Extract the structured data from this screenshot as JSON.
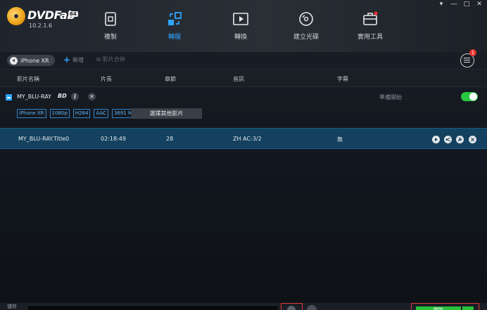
{
  "app": {
    "brand": "DVDFab",
    "bits": "64",
    "version": "10.2.1.6"
  },
  "window_controls": [
    "▾",
    "―",
    "□",
    "✕"
  ],
  "nav": [
    {
      "id": "copy",
      "label": "複製",
      "icon": "copy-icon",
      "active": false
    },
    {
      "id": "ripper",
      "label": "轉檔",
      "icon": "ripper-icon",
      "active": true
    },
    {
      "id": "converter",
      "label": "轉換",
      "icon": "converter-icon",
      "active": false
    },
    {
      "id": "creator",
      "label": "建立光碟",
      "icon": "disc-creator-icon",
      "active": false
    },
    {
      "id": "tools",
      "label": "實用工具",
      "icon": "toolbox-icon",
      "active": false
    }
  ],
  "toolbar": {
    "device": "iPhone XR",
    "add_label": "新增",
    "merge_label": "影片合併",
    "queue_count": "1"
  },
  "columns": {
    "title": "影片名稱",
    "duration": "片長",
    "chapters": "章節",
    "audio": "音訊",
    "subtitle": "字幕"
  },
  "source": {
    "name": "MY_BLU-RAY",
    "status": "準備開始",
    "tags": [
      "iPhone XR",
      "1080p",
      "H264",
      "AAC",
      "3691 MB"
    ],
    "choose_label": "選擇其他影片",
    "bd_icon": "BD"
  },
  "title_row": {
    "name": "MY_BLU-RAY.Title0",
    "duration": "02:18:49",
    "chapters": "28",
    "audio": "ZH  AC-3/2",
    "subtitle": "無"
  },
  "bottom": {
    "save_label": "儲存",
    "start_label": "開始"
  },
  "colors": {
    "accent": "#2ea4ff",
    "selected_row": "#13415f",
    "toggle_on": "#28c840",
    "start_green": "#27c23a",
    "highlight_red": "#e03a3a",
    "badge_red": "#e8322f"
  }
}
